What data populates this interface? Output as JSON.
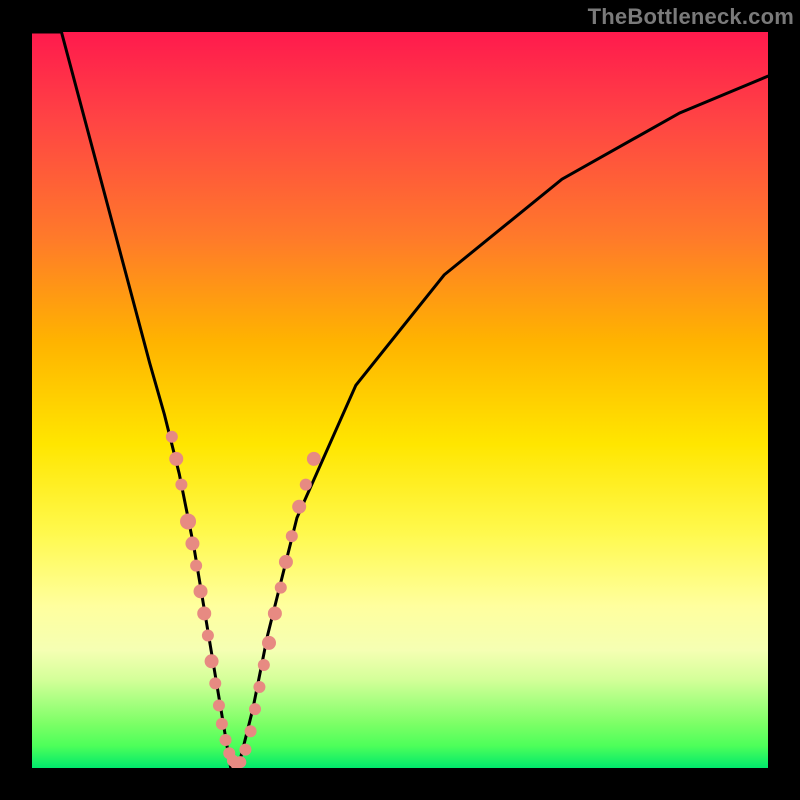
{
  "watermark": "TheBottleneck.com",
  "chart_data": {
    "type": "line",
    "title": "",
    "xlabel": "",
    "ylabel": "",
    "xlim": [
      0,
      100
    ],
    "ylim": [
      0,
      100
    ],
    "grid": false,
    "series": [
      {
        "name": "bottleneck-curve",
        "x": [
          0,
          4,
          8,
          12,
          16,
          18,
          20,
          22,
          24,
          26,
          27,
          28,
          30,
          32,
          36,
          44,
          56,
          72,
          88,
          100
        ],
        "values": [
          115,
          100,
          85,
          70,
          55,
          48,
          40,
          30,
          18,
          6,
          0,
          0,
          8,
          18,
          34,
          52,
          67,
          80,
          89,
          94
        ]
      }
    ],
    "markers": {
      "name": "highlight-dots",
      "color": "#e78a82",
      "points": [
        {
          "x": 19.0,
          "y": 45.0,
          "r": 6
        },
        {
          "x": 19.6,
          "y": 42.0,
          "r": 7
        },
        {
          "x": 20.3,
          "y": 38.5,
          "r": 6
        },
        {
          "x": 21.2,
          "y": 33.5,
          "r": 8
        },
        {
          "x": 21.8,
          "y": 30.5,
          "r": 7
        },
        {
          "x": 22.3,
          "y": 27.5,
          "r": 6
        },
        {
          "x": 22.9,
          "y": 24.0,
          "r": 7
        },
        {
          "x": 23.4,
          "y": 21.0,
          "r": 7
        },
        {
          "x": 23.9,
          "y": 18.0,
          "r": 6
        },
        {
          "x": 24.4,
          "y": 14.5,
          "r": 7
        },
        {
          "x": 24.9,
          "y": 11.5,
          "r": 6
        },
        {
          "x": 25.4,
          "y": 8.5,
          "r": 6
        },
        {
          "x": 25.8,
          "y": 6.0,
          "r": 6
        },
        {
          "x": 26.3,
          "y": 3.8,
          "r": 6
        },
        {
          "x": 26.8,
          "y": 2.0,
          "r": 6
        },
        {
          "x": 27.3,
          "y": 1.0,
          "r": 6
        },
        {
          "x": 27.8,
          "y": 0.5,
          "r": 6
        },
        {
          "x": 28.3,
          "y": 0.8,
          "r": 6
        },
        {
          "x": 29.0,
          "y": 2.5,
          "r": 6
        },
        {
          "x": 29.7,
          "y": 5.0,
          "r": 6
        },
        {
          "x": 30.3,
          "y": 8.0,
          "r": 6
        },
        {
          "x": 30.9,
          "y": 11.0,
          "r": 6
        },
        {
          "x": 31.5,
          "y": 14.0,
          "r": 6
        },
        {
          "x": 32.2,
          "y": 17.0,
          "r": 7
        },
        {
          "x": 33.0,
          "y": 21.0,
          "r": 7
        },
        {
          "x": 33.8,
          "y": 24.5,
          "r": 6
        },
        {
          "x": 34.5,
          "y": 28.0,
          "r": 7
        },
        {
          "x": 35.3,
          "y": 31.5,
          "r": 6
        },
        {
          "x": 36.3,
          "y": 35.5,
          "r": 7
        },
        {
          "x": 37.2,
          "y": 38.5,
          "r": 6
        },
        {
          "x": 38.3,
          "y": 42.0,
          "r": 7
        }
      ]
    }
  }
}
